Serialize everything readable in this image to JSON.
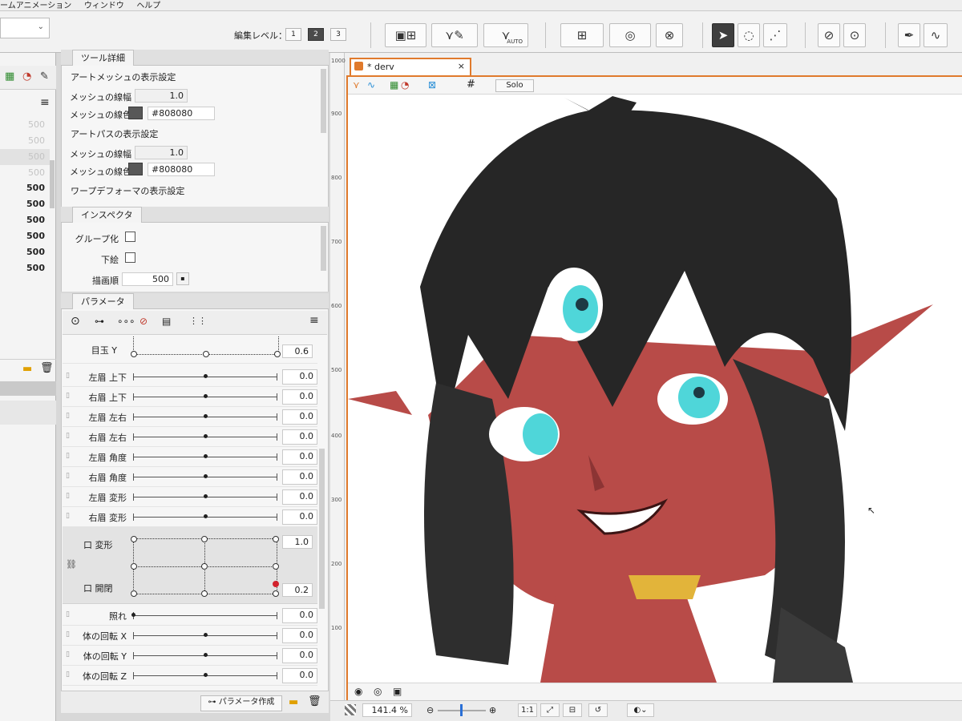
{
  "menubar": {
    "items": [
      "ームアニメーション",
      "ウィンドウ",
      "ヘルプ"
    ]
  },
  "toolbar": {
    "edit_level_label": "編集レベル：",
    "levels": [
      "1",
      "2",
      "3"
    ],
    "auto_label": "AUTO"
  },
  "left_panel": {
    "values": [
      "500",
      "500",
      "500",
      "500",
      "500",
      "500",
      "500",
      "500",
      "500",
      "500"
    ]
  },
  "tool_details": {
    "tab": "ツール詳細",
    "art_mesh_section": "アートメッシュの表示設定",
    "mesh_line_width_label": "メッシュの線幅",
    "mesh_line_width_value": "1.0",
    "mesh_line_color_label": "メッシュの線色",
    "mesh_line_color_value": "#808080",
    "art_path_section": "アートパスの表示設定",
    "path_line_width_label": "メッシュの線幅",
    "path_line_width_value": "1.0",
    "path_line_color_label": "メッシュの線色",
    "path_line_color_value": "#808080",
    "warp_section": "ワープデフォーマの表示設定"
  },
  "inspector": {
    "tab": "インスペクタ",
    "group_label": "グループ化",
    "underlay_label": "下絵",
    "draw_order_label": "描画順",
    "draw_order_value": "500"
  },
  "parameters": {
    "tab": "パラメータ",
    "eye_y": {
      "name": "目玉 Y",
      "value": "0.6"
    },
    "rows": [
      {
        "name": "左眉 上下",
        "value": "0.0",
        "pos": 0.5
      },
      {
        "name": "右眉 上下",
        "value": "0.0",
        "pos": 0.5
      },
      {
        "name": "左眉 左右",
        "value": "0.0",
        "pos": 0.5
      },
      {
        "name": "右眉 左右",
        "value": "0.0",
        "pos": 0.5
      },
      {
        "name": "左眉 角度",
        "value": "0.0",
        "pos": 0.5
      },
      {
        "name": "右眉 角度",
        "value": "0.0",
        "pos": 0.5
      },
      {
        "name": "左眉 変形",
        "value": "0.0",
        "pos": 0.5
      },
      {
        "name": "右眉 変形",
        "value": "0.0",
        "pos": 0.5
      }
    ],
    "mouth_form": {
      "name": "口 変形",
      "value": "1.0"
    },
    "mouth_open": {
      "name": "口 開閉",
      "value": "0.2"
    },
    "rows2": [
      {
        "name": "照れ",
        "value": "0.0",
        "pos": 0.0
      },
      {
        "name": "体の回転 X",
        "value": "0.0",
        "pos": 0.5
      },
      {
        "name": "体の回転 Y",
        "value": "0.0",
        "pos": 0.5
      },
      {
        "name": "体の回転 Z",
        "value": "0.0",
        "pos": 0.5
      }
    ],
    "create_button": "パラメータ作成"
  },
  "editor": {
    "doc_tab": "* derv",
    "solo_label": "Solo",
    "ruler_labels": [
      "1000",
      "900",
      "800",
      "700",
      "600",
      "500",
      "400",
      "300",
      "200",
      "100"
    ],
    "zoom": "141.4 %",
    "ratio_button": "1:1"
  },
  "colors": {
    "accent": "#e07a2c",
    "skin": "#b84b48",
    "hair": "#262626",
    "eyes": "#4fd6d9"
  }
}
